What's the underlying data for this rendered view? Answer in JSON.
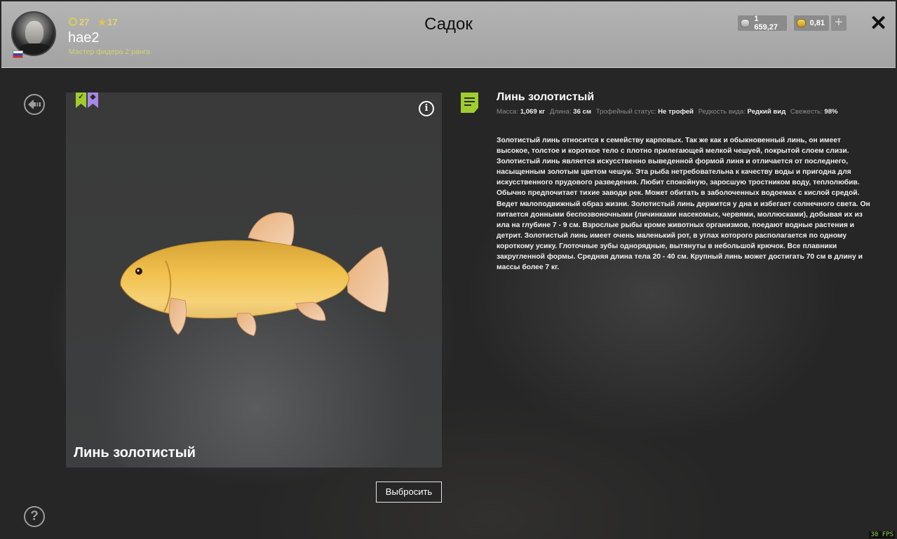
{
  "header": {
    "title": "Садок",
    "player": {
      "nickname": "hae2",
      "rank": "Мастер фидера 2 ранга",
      "level": "27",
      "stars": "17"
    },
    "wallet": {
      "silver": "1 659,27",
      "gold": "0,81"
    },
    "add_currency_label": "+",
    "close_label": "✕"
  },
  "fish": {
    "card_name": "Линь золотистый",
    "title": "Линь золотистый",
    "specs": {
      "mass_label": "Масса:",
      "mass": "1,069 кг",
      "length_label": "Длина:",
      "length": "36 см",
      "trophy_label": "Трофейный статус:",
      "trophy": "Не трофей",
      "rarity_label": "Редкость вида:",
      "rarity": "Редкий вид",
      "freshness_label": "Свежесть:",
      "freshness": "98%"
    },
    "description": "Золотистый линь относится к семейству карповых. Так же как и обыкновенный линь, он имеет высокое, толстое и короткое тело с плотно прилегающей мелкой чешуей, покрытой слоем слизи. Золотистый линь является искусственно выведенной формой линя и отличается от последнего, насыщенным золотым цветом чешуи. Эта рыба нетребовательна к качеству воды и пригодна для искусственного прудового разведения. Любит спокойную, заросшую тростником воду, теплолюбив. Обычно предпочитает тихие заводи рек. Может обитать в заболоченных водоемах с кислой средой. Ведет малоподвижный образ жизни. Золотистый линь держится у дна и избегает солнечного света. Он питается донными беспозвоночными (личинками насекомых, червями, моллюсками), добывая их из ила на глубине 7 - 9 см. Взрослые рыбы кроме животных организмов, поедают водные растения и детрит. Золотистый линь имеет очень маленький рот, в углах которого располагается по одному короткому усику. Глоточные зубы однорядные, вытянуты в небольшой крючок. Все плавники закругленной формы. Средняя длина тела 20 - 40 см. Крупный линь может достигать 70 см в длину и массы более 7 кг."
  },
  "actions": {
    "discard_label": "Выбросить"
  },
  "icons": {
    "info": "i",
    "help": "?",
    "back": "back-arrow-icon"
  },
  "fps_text": "30 FPS",
  "colors": {
    "accent_green": "#9fcd2e",
    "accent_purple": "#a887e6"
  }
}
